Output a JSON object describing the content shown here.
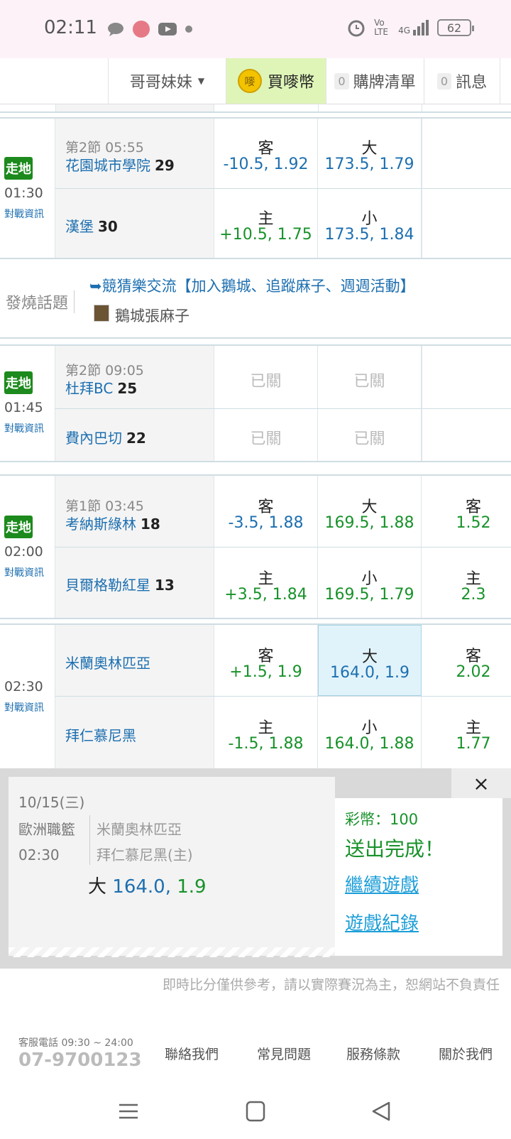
{
  "status": {
    "time": "02:11",
    "battery": "62",
    "volte": "Vo LTE",
    "net": "4G"
  },
  "nav": {
    "user": "哥哥妹妹",
    "coin_icon": "嘜",
    "coin": "買嘜幣",
    "cart_count": "0",
    "cart": "購牌清單",
    "msg_count": "0",
    "msg": "訊息"
  },
  "game1": {
    "walk": "走地",
    "time": "01:30",
    "info": "對戰資訊",
    "period": "第2節 05:55",
    "away": "花園城市學院",
    "away_score": "29",
    "home": "漢堡",
    "home_score": "30",
    "r1": {
      "l1": "客",
      "v1": "-10.5, 1.92",
      "l2": "大",
      "v2": "173.5, 1.79"
    },
    "r2": {
      "l1": "主",
      "v1": "+10.5, 1.75",
      "l2": "小",
      "v2": "173.5, 1.84"
    }
  },
  "topic": {
    "label": "發燒話題",
    "link": "➥競猜樂交流【加入鵝城、追蹤麻子、週週活動】",
    "author": "鵝城張麻子"
  },
  "game2": {
    "walk": "走地",
    "time": "01:45",
    "info": "對戰資訊",
    "period": "第2節 09:05",
    "away": "杜拜BC",
    "away_score": "25",
    "home": "費內巴切",
    "home_score": "22",
    "closed": "已關"
  },
  "game3": {
    "walk": "走地",
    "time": "02:00",
    "info": "對戰資訊",
    "period": "第1節 03:45",
    "away": "考納斯綠林",
    "away_score": "18",
    "home": "貝爾格勒紅星",
    "home_score": "13",
    "r1": {
      "l1": "客",
      "v1": "-3.5, 1.88",
      "l2": "大",
      "v2": "169.5, 1.88",
      "l3": "客",
      "v3": "1.52"
    },
    "r2": {
      "l1": "主",
      "v1": "+3.5, 1.84",
      "l2": "小",
      "v2": "169.5, 1.79",
      "l3": "主",
      "v3": "2.3"
    }
  },
  "game4": {
    "time": "02:30",
    "info": "對戰資訊",
    "away": "米蘭奧林匹亞",
    "home": "拜仁慕尼黑",
    "r1": {
      "l1": "客",
      "v1": "+1.5, 1.9",
      "l2": "大",
      "v2": "164.0, 1.9",
      "l3": "客",
      "v3": "2.02"
    },
    "r2": {
      "l1": "主",
      "v1": "-1.5, 1.88",
      "l2": "小",
      "v2": "164.0, 1.88",
      "l3": "主",
      "v3": "1.77"
    }
  },
  "ticket": {
    "date": "10/15(三)",
    "league": "歐洲職籃",
    "time": "02:30",
    "team1": "米蘭奧林匹亞",
    "team2": "拜仁慕尼黑(主)",
    "bet_label": "大",
    "bet_value": "164.0,",
    "bet_odds": "1.9",
    "coins": "彩幣：100",
    "sent": "送出完成！",
    "continue": "繼續遊戲",
    "history": "遊戲紀錄",
    "close": "×"
  },
  "disclaimer": "即時比分僅供參考，請以實際賽況為主，恕網站不負責任",
  "footer": {
    "phone_label": "客服電話 09:30 ~ 24:00",
    "phone": "07-9700123",
    "links": [
      "聯絡我們",
      "常見問題",
      "服務條款",
      "關於我們"
    ]
  }
}
